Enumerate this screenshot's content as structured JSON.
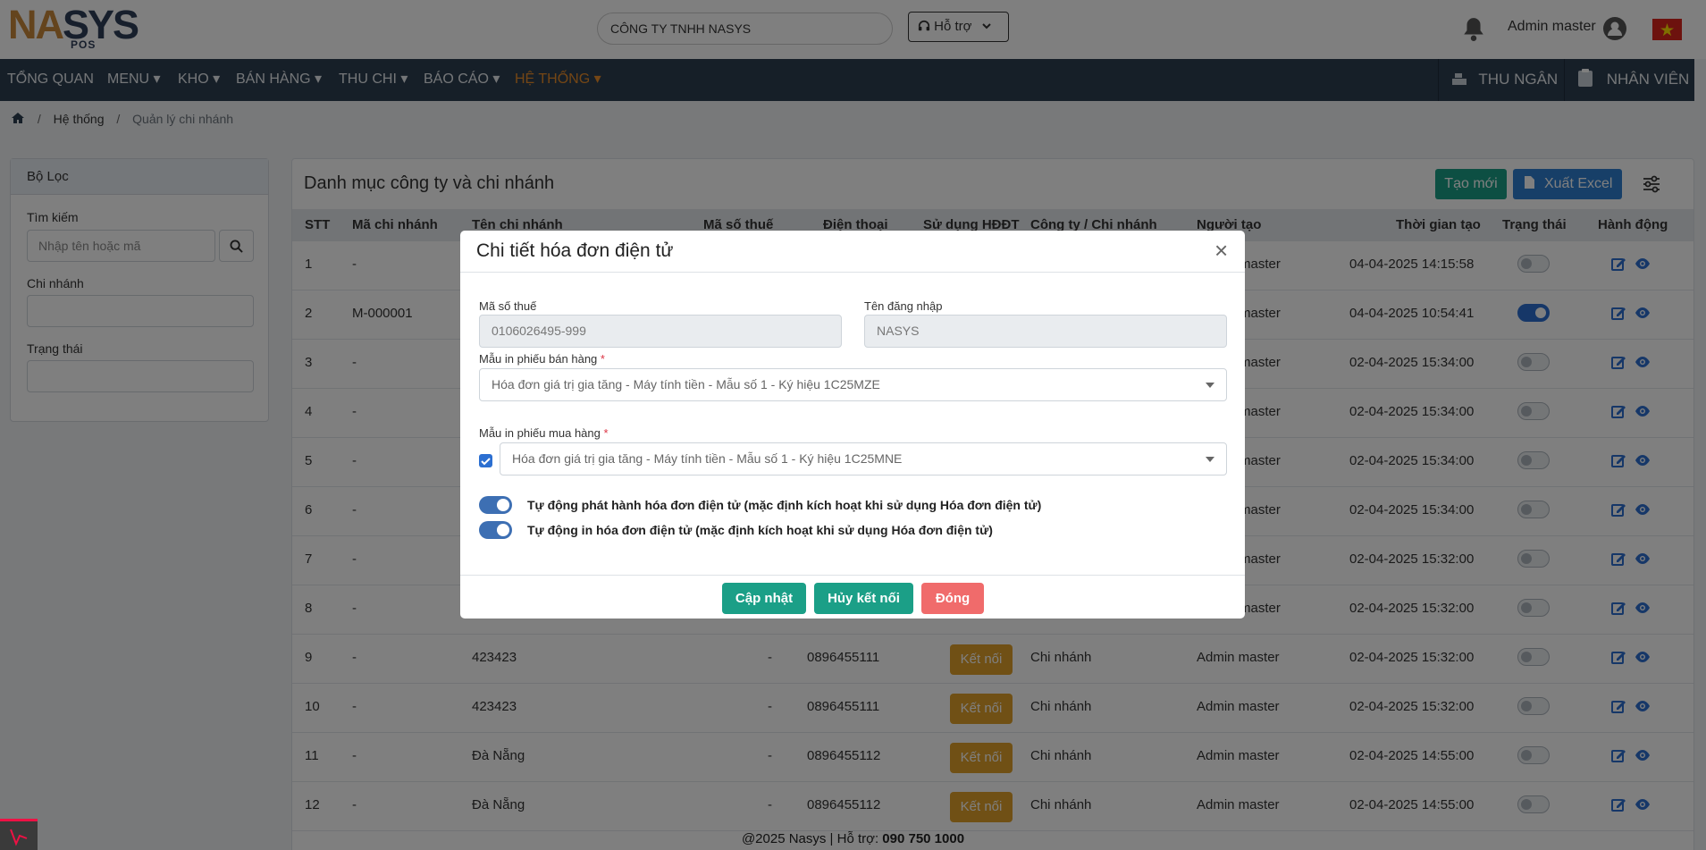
{
  "header": {
    "logo_main": "NASYS",
    "logo_sub": "POS",
    "company": "CÔNG TY TNHH NASYS",
    "support_label": "Hỗ trợ",
    "user_name": "Admin master"
  },
  "nav": {
    "items": [
      "TỔNG QUAN",
      "MENU",
      "KHO",
      "BÁN HÀNG",
      "THU CHI",
      "BÁO CÁO",
      "HỆ THỐNG"
    ],
    "cashier": "THU NGÂN",
    "staff": "NHÂN VIÊN"
  },
  "breadcrumb": {
    "level1": "Hệ thống",
    "level2": "Quản lý chi nhánh"
  },
  "filter": {
    "title": "Bộ Lọc",
    "search_label": "Tìm kiếm",
    "search_placeholder": "Nhập tên hoặc mã",
    "branch_label": "Chi nhánh",
    "status_label": "Trạng thái"
  },
  "main": {
    "title": "Danh mục công ty và chi nhánh",
    "new_button": "Tạo mới",
    "excel_button": "Xuất Excel",
    "columns": [
      "STT",
      "Mã chi nhánh",
      "Tên chi nhánh",
      "Mã số thuế",
      "Điện thoại",
      "Sử dụng HĐĐT",
      "Công ty / Chi nhánh",
      "Người tạo",
      "Thời gian tạo",
      "Trạng thái",
      "Hành động"
    ],
    "rows": [
      {
        "stt": "1",
        "code": "-",
        "name": "",
        "tax": "",
        "phone": "",
        "einvoice": "",
        "type": "",
        "creator": "master",
        "created": "04-04-2025 14:15:58",
        "active": false
      },
      {
        "stt": "2",
        "code": "M-000001",
        "name": "",
        "tax": "",
        "phone": "",
        "einvoice": "",
        "type": "",
        "creator": "master",
        "created": "04-04-2025 10:54:41",
        "active": true
      },
      {
        "stt": "3",
        "code": "-",
        "name": "",
        "tax": "",
        "phone": "",
        "einvoice": "",
        "type": "",
        "creator": "master",
        "created": "02-04-2025 15:34:00",
        "active": false
      },
      {
        "stt": "4",
        "code": "-",
        "name": "",
        "tax": "",
        "phone": "",
        "einvoice": "",
        "type": "",
        "creator": "master",
        "created": "02-04-2025 15:34:00",
        "active": false
      },
      {
        "stt": "5",
        "code": "-",
        "name": "",
        "tax": "",
        "phone": "",
        "einvoice": "",
        "type": "",
        "creator": "master",
        "created": "02-04-2025 15:34:00",
        "active": false
      },
      {
        "stt": "6",
        "code": "-",
        "name": "",
        "tax": "",
        "phone": "",
        "einvoice": "",
        "type": "",
        "creator": "master",
        "created": "02-04-2025 15:34:00",
        "active": false
      },
      {
        "stt": "7",
        "code": "-",
        "name": "",
        "tax": "",
        "phone": "",
        "einvoice": "",
        "type": "",
        "creator": "master",
        "created": "02-04-2025 15:32:00",
        "active": false
      },
      {
        "stt": "8",
        "code": "-",
        "name": "",
        "tax": "",
        "phone": "",
        "einvoice": "",
        "type": "",
        "creator": "master",
        "created": "02-04-2025 15:32:00",
        "active": false
      },
      {
        "stt": "9",
        "code": "-",
        "name": "423423",
        "tax": "-",
        "phone": "0896455111",
        "einvoice": "Kết nối",
        "type": "Chi nhánh",
        "creator": "Admin master",
        "created": "02-04-2025 15:32:00",
        "active": false
      },
      {
        "stt": "10",
        "code": "-",
        "name": "423423",
        "tax": "-",
        "phone": "0896455111",
        "einvoice": "Kết nối",
        "type": "Chi nhánh",
        "creator": "Admin master",
        "created": "02-04-2025 15:32:00",
        "active": false
      },
      {
        "stt": "11",
        "code": "-",
        "name": "Đà Nẵng",
        "tax": "-",
        "phone": "0896455112",
        "einvoice": "Kết nối",
        "type": "Chi nhánh",
        "creator": "Admin master",
        "created": "02-04-2025 14:55:00",
        "active": false
      },
      {
        "stt": "12",
        "code": "-",
        "name": "Đà Nẵng",
        "tax": "-",
        "phone": "0896455112",
        "einvoice": "Kết nối",
        "type": "Chi nhánh",
        "creator": "Admin master",
        "created": "02-04-2025 14:55:00",
        "active": false
      }
    ]
  },
  "footer": {
    "text": "@2025 Nasys | Hỗ trợ:",
    "phone": "090 750 1000"
  },
  "modal": {
    "title": "Chi tiết hóa đơn điện tử",
    "tax_label": "Mã số thuế",
    "tax_value": "0106026495-999",
    "username_label": "Tên đăng nhập",
    "username_value": "NASYS",
    "sale_template_label": "Mẫu in phiếu bán hàng",
    "sale_template_value": "Hóa đơn giá trị gia tăng - Máy tính tiền - Mẫu số 1 - Ký hiệu 1C25MZE",
    "purchase_template_label": "Mẫu in phiếu mua hàng",
    "purchase_template_value": "Hóa đơn giá trị gia tăng - Máy tính tiền - Mẫu số 1 - Ký hiệu 1C25MNE",
    "auto_issue_label": "Tự động phát hành hóa đơn điện tử (mặc định kích hoạt khi sử dụng Hóa đơn điện tử)",
    "auto_print_label": "Tự động in hóa đơn điện tử (mặc định kích hoạt khi sử dụng Hóa đơn điện tử)",
    "update_button": "Cập nhật",
    "disconnect_button": "Hủy kết nối",
    "close_button": "Đóng",
    "required_mark": "*",
    "close_symbol": "×"
  },
  "colors": {
    "nav_bg": "#2c3e50",
    "nav_active": "#e88c2a",
    "teal": "#1b9f87",
    "blue": "#2e7fd1",
    "connect": "#e0a12a",
    "close_btn": "#f06b6b"
  }
}
